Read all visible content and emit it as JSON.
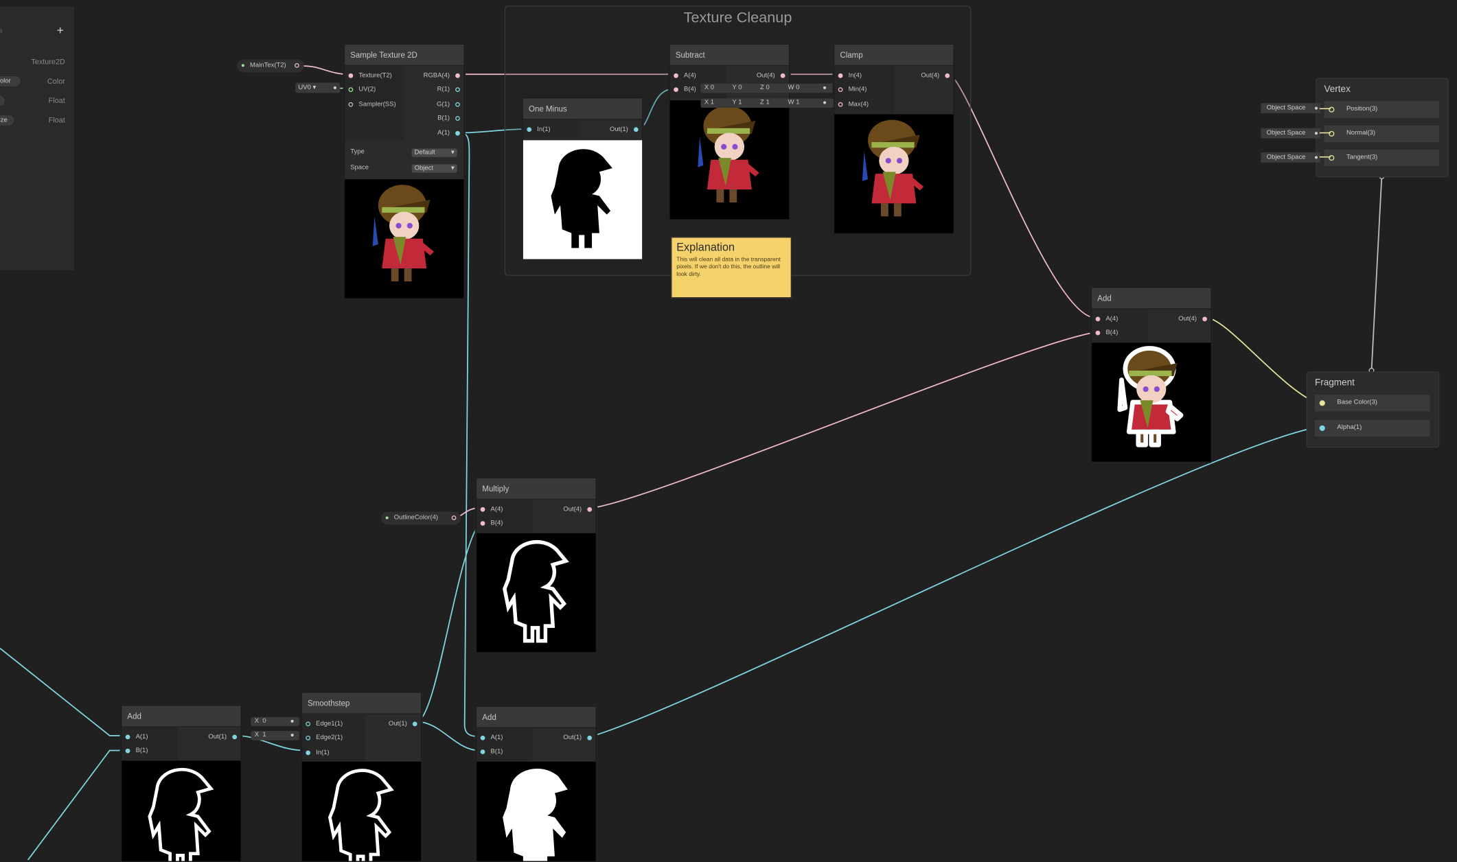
{
  "colors": {
    "background": "#202020",
    "wire_pink": "#f2b9d4",
    "wire_cyan": "#7fd6df",
    "wire_yellow": "#e6e49a",
    "wire_gray": "#bfbfbf",
    "sticky_note": "#f5d26b"
  },
  "blackboard": {
    "add_icon": "+",
    "rows": [
      {
        "name_fragment": "s",
        "type": "Texture2D"
      },
      {
        "name_fragment": "olor",
        "type": "Color"
      },
      {
        "name_fragment": "",
        "type": "Float"
      },
      {
        "name_fragment": "ize",
        "type": "Float"
      }
    ]
  },
  "group": {
    "title": "Texture Cleanup"
  },
  "properties": {
    "main_tex": "MainTex(T2)",
    "outline_color": "OutlineColor(4)",
    "uv_dropdown": "UV0"
  },
  "sample_texture": {
    "title": "Sample Texture 2D",
    "inputs": [
      "Texture(T2)",
      "UV(2)",
      "Sampler(SS)"
    ],
    "outputs": [
      "RGBA(4)",
      "R(1)",
      "G(1)",
      "B(1)",
      "A(1)"
    ],
    "type_label": "Type",
    "type_value": "Default",
    "space_label": "Space",
    "space_value": "Object"
  },
  "one_minus": {
    "title": "One Minus",
    "input": "In(1)",
    "output": "Out(1)"
  },
  "subtract": {
    "title": "Subtract",
    "inputs": [
      "A(4)",
      "B(4)"
    ],
    "output": "Out(4)",
    "b_fields": [
      {
        "axis": "X",
        "value": "0"
      },
      {
        "axis": "Y",
        "value": "0"
      },
      {
        "axis": "Z",
        "value": "0"
      },
      {
        "axis": "W",
        "value": "0"
      }
    ]
  },
  "clamp": {
    "title": "Clamp",
    "inputs": [
      "In(4)",
      "Min(4)",
      "Max(4)"
    ],
    "output": "Out(4)",
    "max_fields": [
      {
        "axis": "X",
        "value": "1"
      },
      {
        "axis": "Y",
        "value": "1"
      },
      {
        "axis": "Z",
        "value": "1"
      },
      {
        "axis": "W",
        "value": "1"
      }
    ]
  },
  "note": {
    "title": "Explanation",
    "body": "This will clean all data in the transparent pixels. If we don't do this, the outline will look dirty."
  },
  "add_main": {
    "title": "Add",
    "inputs": [
      "A(4)",
      "B(4)"
    ],
    "output": "Out(4)"
  },
  "multiply": {
    "title": "Multiply",
    "inputs": [
      "A(4)",
      "B(4)"
    ],
    "output": "Out(4)"
  },
  "add_left": {
    "title": "Add",
    "inputs": [
      "A(1)",
      "B(1)"
    ],
    "output": "Out(1)"
  },
  "smoothstep": {
    "title": "Smoothstep",
    "inputs": [
      "Edge1(1)",
      "Edge2(1)",
      "In(1)"
    ],
    "output": "Out(1)",
    "edge_fields": [
      {
        "axis": "X",
        "value": "0"
      },
      {
        "axis": "X",
        "value": "1"
      }
    ]
  },
  "add_bottom": {
    "title": "Add",
    "inputs": [
      "A(1)",
      "B(1)"
    ],
    "output": "Out(1)"
  },
  "vertex": {
    "title": "Vertex",
    "blocks": [
      "Position(3)",
      "Normal(3)",
      "Tangent(3)"
    ],
    "space": "Object Space"
  },
  "fragment": {
    "title": "Fragment",
    "blocks": [
      "Base Color(3)",
      "Alpha(1)"
    ]
  }
}
